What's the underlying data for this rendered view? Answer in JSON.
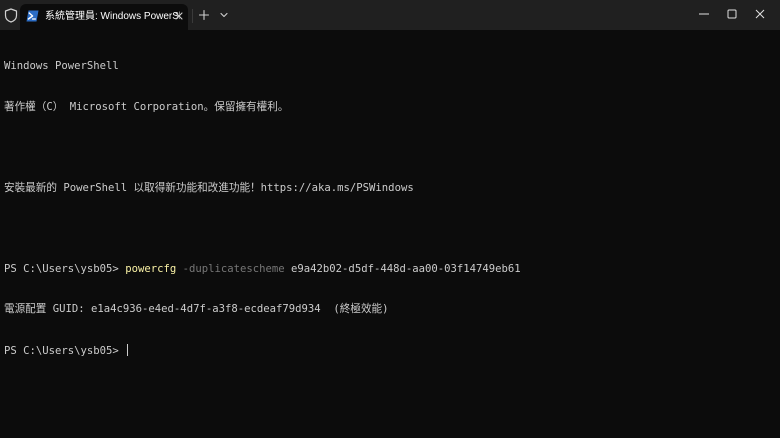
{
  "tab": {
    "title": "系統管理員: Windows PowerSl"
  },
  "terminal": {
    "banner_line1": "Windows PowerShell",
    "banner_line2": "著作權（C） Microsoft Corporation。保留擁有權利。",
    "banner_line3": "安裝最新的 PowerShell 以取得新功能和改進功能！https://aka.ms/PSWindows",
    "prompt1": "PS C:\\Users\\ysb05> ",
    "command": "powercfg",
    "param": " -duplicatescheme",
    "argument": " e9a42b02-d5df-448d-aa00-03f14749eb61",
    "output_line": "電源配置 GUID: e1a4c936-e4ed-4d7f-a3f8-ecdeaf79d934  (終極效能)",
    "prompt2": "PS C:\\Users\\ysb05> "
  },
  "colors": {
    "background": "#0c0c0c",
    "titlebar": "#202020",
    "text": "#cccccc",
    "command": "#f9f1a5",
    "parameter": "#767676"
  },
  "icons": {
    "shield": "shield-icon",
    "tab": "powershell-icon",
    "close": "close-icon",
    "new_tab": "plus-icon",
    "dropdown": "chevron-down-icon",
    "minimize": "minimize-icon",
    "maximize": "maximize-icon",
    "window_close": "window-close-icon"
  }
}
